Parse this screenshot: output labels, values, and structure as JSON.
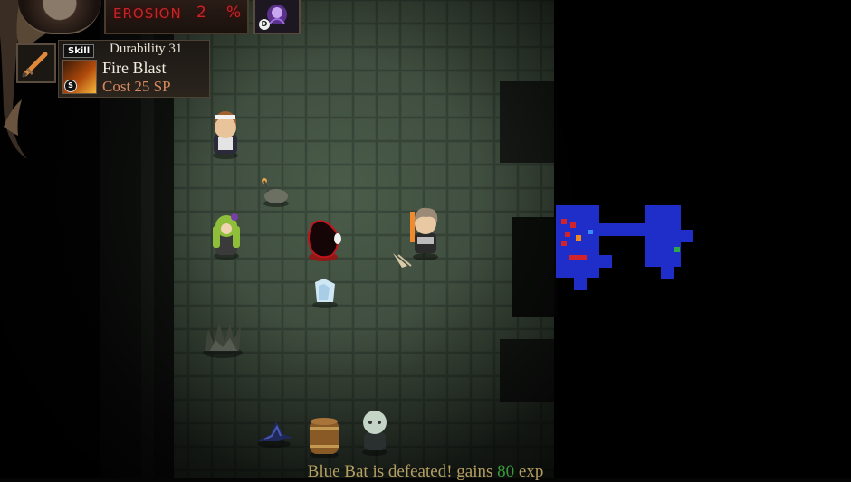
{
  "hud": {
    "erosion_label": "EROSION",
    "erosion_value": "2",
    "erosion_unit": "%",
    "curse_key": "D",
    "skill_tag": "Skill",
    "durability": "Durability 31",
    "skill_name": "Fire Blast",
    "skill_cost": "Cost 25 SP",
    "skill_key": "S"
  },
  "message": {
    "part1": "Blue Bat is defeated! gains ",
    "exp_value": "80",
    "part2": " exp"
  },
  "minimap_colors": {
    "rooms": "#1f2ec8",
    "enemies": "#d2232a",
    "item": "#f08a1c",
    "stairs": "#2aa84a",
    "player": "#3a8cff"
  }
}
